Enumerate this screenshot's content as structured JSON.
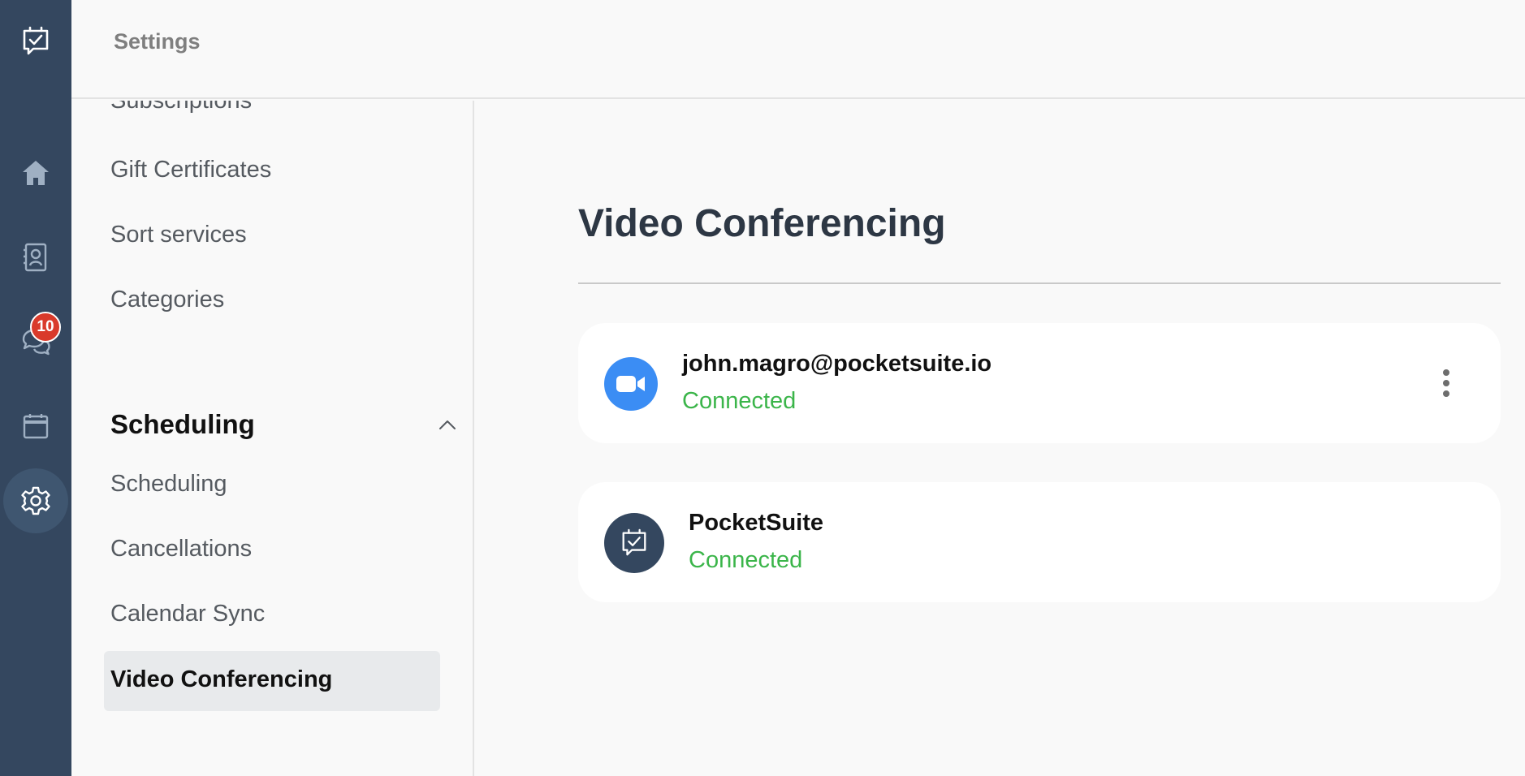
{
  "app": {
    "colors": {
      "rail": "#34475f",
      "active_rail_item": "#3f5670",
      "badge": "#d93a2b",
      "status_connected": "#3bb54a",
      "zoom_blue": "#3b8df4"
    }
  },
  "rail": {
    "items": [
      {
        "icon": "pocketsuite-logo-icon"
      },
      {
        "icon": "home-icon"
      },
      {
        "icon": "contacts-icon"
      },
      {
        "icon": "messages-icon",
        "badge": "10"
      },
      {
        "icon": "calendar-icon"
      },
      {
        "icon": "gear-icon",
        "active": true
      }
    ]
  },
  "topbar": {
    "title": "Settings"
  },
  "submenu": {
    "items_top": [
      "Subscriptions",
      "Gift Certificates",
      "Sort services",
      "Categories"
    ],
    "section": {
      "title": "Scheduling",
      "expanded_icon": "chevron-up-icon",
      "items": [
        "Scheduling",
        "Cancellations",
        "Calendar Sync",
        "Video Conferencing"
      ],
      "active": "Video Conferencing"
    }
  },
  "main": {
    "title": "Video Conferencing",
    "connections": [
      {
        "icon": "video-camera-icon",
        "name": "john.magro@pocketsuite.io",
        "status": "Connected",
        "has_menu": true
      },
      {
        "icon": "pocketsuite-logo-icon",
        "name": "PocketSuite",
        "status": "Connected",
        "has_menu": false
      }
    ]
  }
}
